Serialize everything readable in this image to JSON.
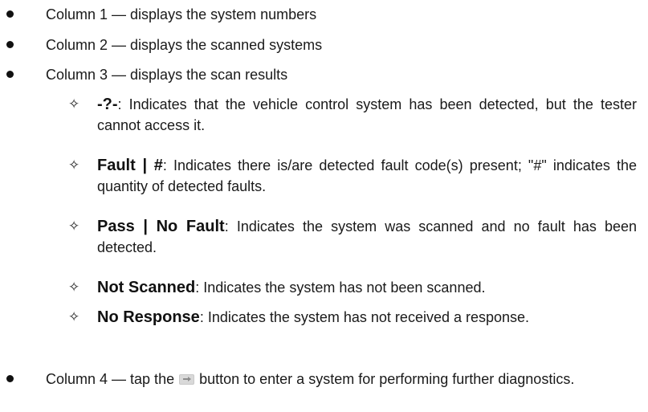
{
  "columns": [
    {
      "label": "Column 1 — displays the system numbers"
    },
    {
      "label": "Column 2 — displays the scanned systems"
    },
    {
      "label": "Column 3 — displays the scan results"
    }
  ],
  "results": [
    {
      "term": "-?-",
      "desc": ": Indicates that the vehicle control system has been detected, but the tester cannot access it."
    },
    {
      "term": "Fault | #",
      "desc": ": Indicates there is/are detected fault code(s) present; \"#\" indicates the quantity of detected faults."
    },
    {
      "term": "Pass | No Fault",
      "desc": ": Indicates the system was scanned and no fault has been detected."
    },
    {
      "term": "Not Scanned",
      "desc": ": Indicates the system has not been scanned."
    },
    {
      "term": "No Response",
      "desc": ": Indicates the system has not received a response."
    }
  ],
  "column4": {
    "before": "Column 4 — tap the",
    "after": "button to enter a system for performing further diagnostics.",
    "icon": "arrow-right-icon"
  },
  "symbols": {
    "bullet": "bullet-dot",
    "sub_bullet": "✧"
  }
}
